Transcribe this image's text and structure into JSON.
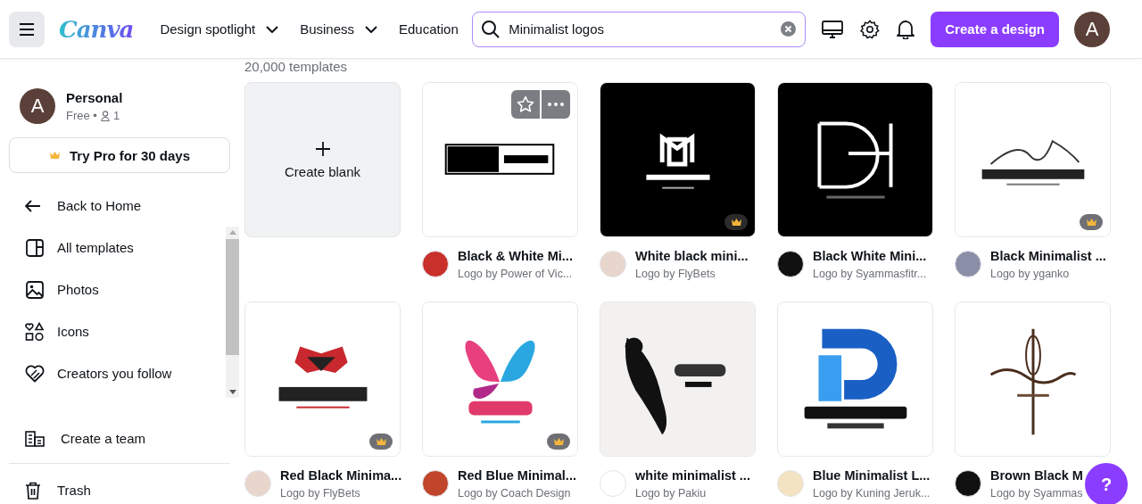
{
  "header": {
    "logo": "Canva",
    "nav": [
      {
        "label": "Design spotlight"
      },
      {
        "label": "Business"
      },
      {
        "label": "Education"
      }
    ],
    "search": {
      "value": "Minimalist logos"
    },
    "create_button": "Create a design",
    "avatar": "A"
  },
  "sidebar": {
    "account": {
      "avatar": "A",
      "name": "Personal",
      "plan": "Free •",
      "members": "1"
    },
    "pro_button": "Try Pro for 30 days",
    "back": "Back to Home",
    "items": [
      {
        "kind": "templates",
        "label": "All templates"
      },
      {
        "kind": "photos",
        "label": "Photos"
      },
      {
        "kind": "icons",
        "label": "Icons"
      },
      {
        "kind": "creators",
        "label": "Creators you follow"
      }
    ],
    "team": "Create a team",
    "trash": "Trash"
  },
  "results": {
    "count": "20,000 templates",
    "blank": "Create blank",
    "templates": [
      {
        "title": "Black & White Mi...",
        "author": "Logo by Power of Vic...",
        "pro": false,
        "hovered": true
      },
      {
        "title": "White black mini...",
        "author": "Logo by FlyBets",
        "pro": true,
        "hovered": false
      },
      {
        "title": "Black White Mini...",
        "author": "Logo by Syammasfitr...",
        "pro": false,
        "hovered": false
      },
      {
        "title": "Black Minimalist ...",
        "author": "Logo by yganko",
        "pro": true,
        "hovered": false
      },
      {
        "title": "Red Black Minima...",
        "author": "Logo by FlyBets",
        "pro": true,
        "hovered": false
      },
      {
        "title": "Red Blue Minimal...",
        "author": "Logo by Coach Design",
        "pro": true,
        "hovered": false
      },
      {
        "title": "white minimalist ...",
        "author": "Logo by Pakiu",
        "pro": false,
        "hovered": false
      },
      {
        "title": "Blue Minimalist L...",
        "author": "Logo by Kuning Jeruk...",
        "pro": false,
        "hovered": false
      },
      {
        "title": "Brown Black M",
        "author": "Logo by Syammas",
        "pro": false,
        "hovered": false
      }
    ]
  },
  "help_button": "?"
}
